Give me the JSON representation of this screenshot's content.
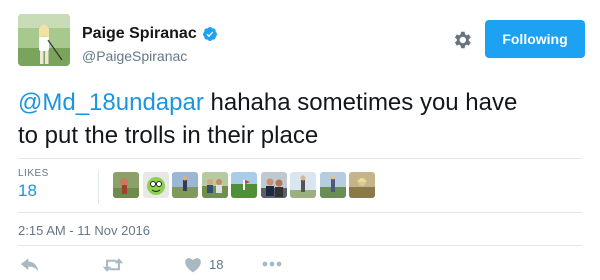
{
  "user": {
    "display_name": "Paige Spiranac",
    "handle": "@PaigeSpiranac",
    "verified": true
  },
  "header": {
    "follow_label": "Following",
    "settings_icon": "gear-icon"
  },
  "tweet": {
    "mention": "@Md_18undapar",
    "text_line1": " hahaha sometimes you have",
    "text_line2": "to put the trolls in their place"
  },
  "stats": {
    "likes_label": "LIKES",
    "likes_count": "18",
    "liker_avatars": 9
  },
  "timestamp": "2:15 AM - 11 Nov 2016",
  "actions": {
    "reply_icon": "reply-icon",
    "retweet_icon": "retweet-icon",
    "like_icon": "heart-icon",
    "like_count": "18",
    "more_icon": "more-icon"
  },
  "colors": {
    "accent": "#1da1f2",
    "link": "#1b95e0",
    "muted": "#657786",
    "divider": "#e1e8ed"
  }
}
